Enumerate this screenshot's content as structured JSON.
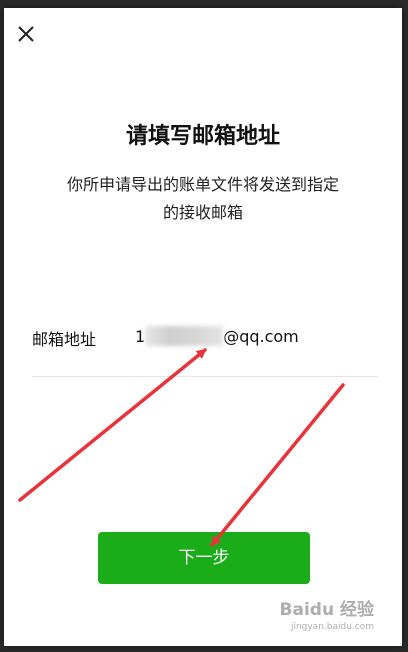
{
  "dialog": {
    "close_icon": "close-icon",
    "title": "请填写邮箱地址",
    "subtitle_line1": "你所申请导出的账单文件将发送到指定",
    "subtitle_line2": "的接收邮箱"
  },
  "email_field": {
    "label": "邮箱地址",
    "value_prefix": "1",
    "value_suffix": "@qq.com",
    "redacted": true
  },
  "next_button": {
    "label": "下一步",
    "color": "#1aad19"
  },
  "annotations": {
    "arrow_color": "#e8333a"
  },
  "watermark": {
    "main": "Baidu 经验",
    "sub": "jingyan.baidu.com"
  }
}
